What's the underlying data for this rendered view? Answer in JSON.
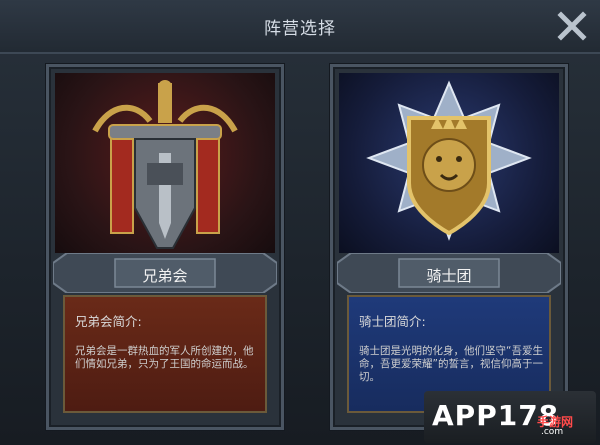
{
  "header": {
    "title": "阵营选择"
  },
  "factions": [
    {
      "name": "兄弟会",
      "info_title": "兄弟会简介:",
      "description": "兄弟会是一群热血的军人所创建的，他们情如兄弟，只为了王国的命运而战。",
      "theme": "#6a2a18"
    },
    {
      "name": "骑士团",
      "info_title": "骑士团简介:",
      "description": "骑士团是光明的化身，他们坚守“吾爱生命，吾更爱荣耀”的誓言，视信仰高于一切。",
      "theme": "#1f3a7a"
    }
  ],
  "watermark": {
    "main": "APP178",
    "sub": "手游网",
    "domain": ".com"
  },
  "colors": {
    "accent_gold": "#c9a24a",
    "brotherhood_red": "#6a2a18",
    "order_blue": "#1f3a7a"
  },
  "icons": {
    "close": "close-icon",
    "emblem_left": "sword-emblem-icon",
    "emblem_right": "lion-shield-emblem-icon"
  }
}
